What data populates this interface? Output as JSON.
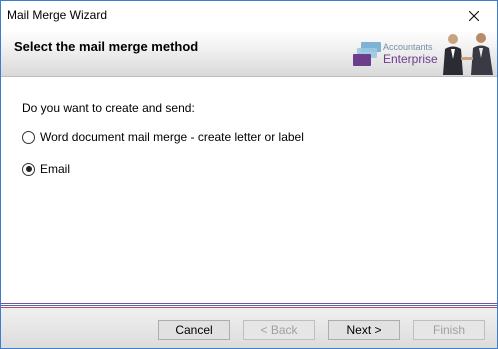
{
  "window": {
    "title": "Mail Merge Wizard"
  },
  "header": {
    "title": "Select the mail merge method",
    "logo_small": "Accountants",
    "logo_big": "Enterprise"
  },
  "content": {
    "question": "Do you want to create and send:",
    "options": [
      {
        "label": "Word document mail merge - create letter or label",
        "selected": false
      },
      {
        "label": "Email",
        "selected": true
      }
    ]
  },
  "footer": {
    "cancel": "Cancel",
    "back": "< Back",
    "next": "Next >",
    "finish": "Finish"
  },
  "colors": {
    "accent_purple": "#6b3d8b",
    "separator_purple": "#7b4fa0",
    "separator_blue": "#4c6da8",
    "separator_red": "#b44c6e"
  }
}
